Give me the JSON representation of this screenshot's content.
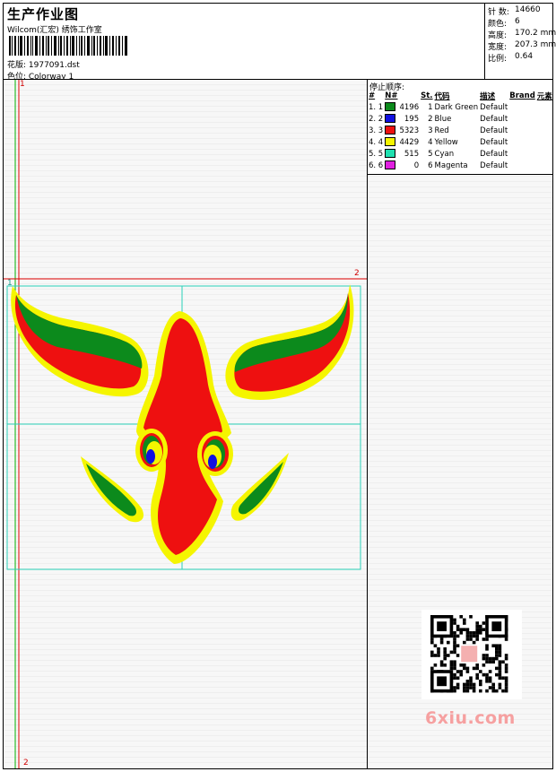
{
  "header": {
    "title": "生产作业图",
    "subtitle": "Wilcom(汇宏) 绣饰工作室",
    "design_label": "花版: 1977091.dst",
    "colorway_label": "色位: Colorway 1"
  },
  "stats": {
    "stitches_label": "针 数:",
    "stitches": "14660",
    "colors_label": "颜色:",
    "colors": "6",
    "height_label": "高度:",
    "height": "170.2 mm",
    "width_label": "宽度:",
    "width": "207.3 mm",
    "scale_label": "比例:",
    "scale": "0.64"
  },
  "stop_sequence": {
    "title": "停止顺序:",
    "columns": [
      "#",
      "N#",
      "St.",
      "代码",
      "描述",
      "Brand",
      "元素"
    ],
    "rows": [
      {
        "idx": "1. 1",
        "color": "#0c8a1c",
        "st": "4196",
        "code": "1",
        "desc": "Dark Green",
        "brand": "Default"
      },
      {
        "idx": "2. 2",
        "color": "#1010e0",
        "st": "195",
        "code": "2",
        "desc": "Blue",
        "brand": "Default"
      },
      {
        "idx": "3. 3",
        "color": "#ee1010",
        "st": "5323",
        "code": "3",
        "desc": "Red",
        "brand": "Default"
      },
      {
        "idx": "4. 4",
        "color": "#f5f500",
        "st": "4429",
        "code": "4",
        "desc": "Yellow",
        "brand": "Default"
      },
      {
        "idx": "5. 5",
        "color": "#20e0b0",
        "st": "515",
        "code": "5",
        "desc": "Cyan",
        "brand": "Default"
      },
      {
        "idx": "6. 6",
        "color": "#e020e0",
        "st": "0",
        "code": "6",
        "desc": "Magenta",
        "brand": "Default"
      }
    ]
  },
  "markers": {
    "m1": "1",
    "m2": "2",
    "m3": "1",
    "m4": "2"
  },
  "watermark": "6xiu.com",
  "colors": {
    "red": "#ee1010",
    "green": "#0c8a1c",
    "yellow": "#f5f500",
    "blue": "#1010e0",
    "guide": "#2ad0b8"
  }
}
